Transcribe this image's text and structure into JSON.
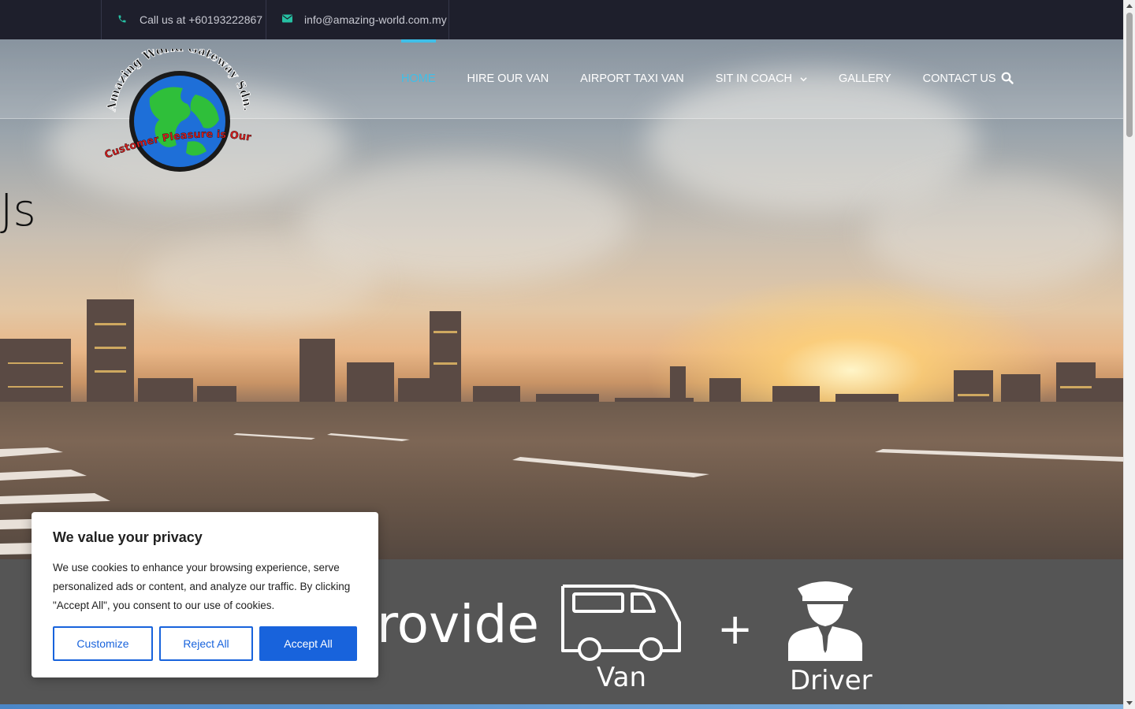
{
  "topbar": {
    "phone_text": "Call us at +60193222867",
    "email_text": "info@amazing-world.com.my"
  },
  "logo": {
    "top_text": "Amazing World Gateway Sdn. Bhd.",
    "bottom_text": "Customer Pleasure is Our Satisfaction"
  },
  "nav": {
    "items": [
      {
        "label": "HOME",
        "active": true
      },
      {
        "label": "HIRE OUR VAN"
      },
      {
        "label": "AIRPORT TAXI VAN"
      },
      {
        "label": "SIT IN COACH",
        "has_dropdown": true
      },
      {
        "label": "GALLERY"
      },
      {
        "label": "CONTACT US"
      }
    ]
  },
  "hero": {
    "partial_text": "Js"
  },
  "band": {
    "provide_text": "rovide",
    "plus": "+",
    "van_label": "Van",
    "driver_label": "Driver"
  },
  "cookie": {
    "title": "We value your privacy",
    "body": "We use cookies to enhance your browsing experience, serve personalized ads or content, and analyze our traffic. By clicking \"Accept All\", you consent to our use of cookies.",
    "customize": "Customize",
    "reject": "Reject All",
    "accept": "Accept All"
  },
  "colors": {
    "accent": "#3fbfe8",
    "topbar_icon": "#26c0a3",
    "cookie_button": "#1863dc",
    "band": "#555555"
  },
  "icons": {
    "phone": "phone-icon",
    "email": "envelope-icon",
    "search": "search-icon",
    "van": "van-icon",
    "driver": "driver-icon"
  }
}
